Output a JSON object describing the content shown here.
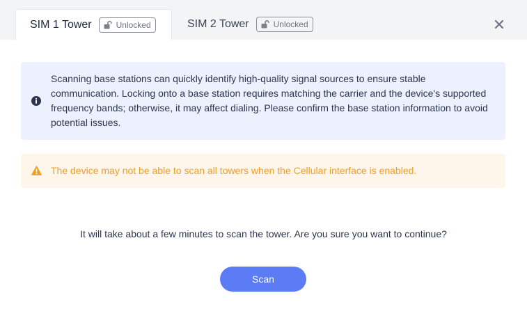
{
  "tabs": [
    {
      "label": "SIM 1 Tower",
      "badge": "Unlocked",
      "badge_icon": "unlock-icon",
      "active": true
    },
    {
      "label": "SIM 2 Tower",
      "badge": "Unlocked",
      "badge_icon": "unlock-icon",
      "active": false
    }
  ],
  "close_icon": "close-icon",
  "info": {
    "icon": "info-icon",
    "text": "Scanning base stations can quickly identify high-quality signal sources to ensure stable communication. Locking onto a base station requires matching the carrier and the device's supported frequency bands; otherwise, it may affect dialing. Please confirm the base station information to avoid potential issues."
  },
  "warning": {
    "icon": "warning-icon",
    "text": "The device may not be able to scan all towers when the Cellular interface is enabled."
  },
  "confirm_text": "It will take about a few minutes to scan the tower. Are you sure you want to continue?",
  "scan_button": "Scan",
  "colors": {
    "accent": "#5b7cf5",
    "info_bg": "#edf1fd",
    "warning_bg": "#fef6eb",
    "warning_text": "#f0a020"
  }
}
